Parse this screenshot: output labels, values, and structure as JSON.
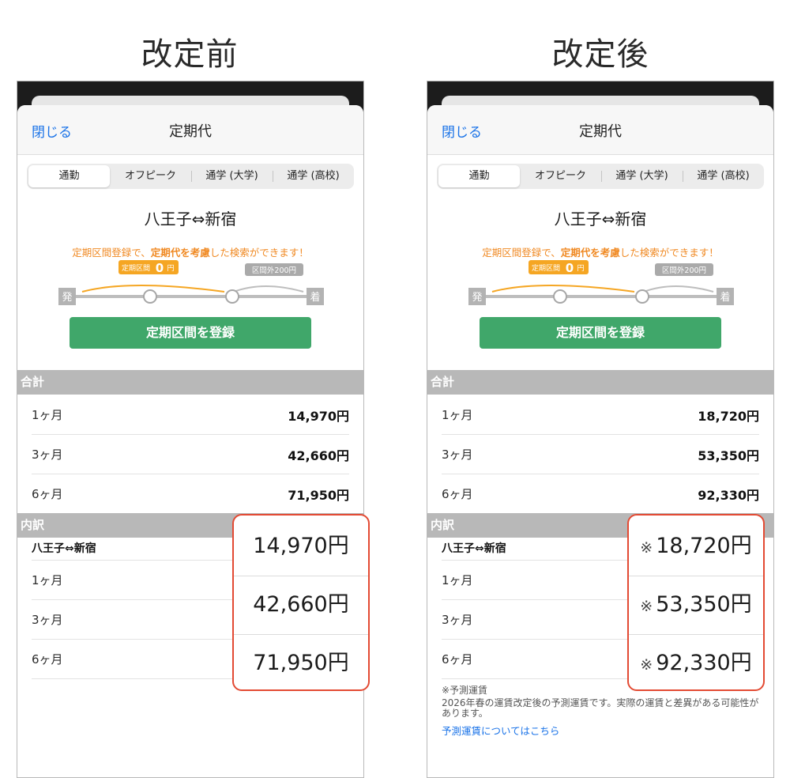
{
  "before": {
    "heading": "改定前",
    "nav": {
      "close_label": "閉じる",
      "title": "定期代"
    },
    "segments": [
      "通勤",
      "オフピーク",
      "通学 (大学)",
      "通学 (高校)"
    ],
    "route": "八王子⇔新宿",
    "promo": {
      "pre": "定期区間登録で、",
      "bold": "定期代を考慮",
      "post": "した検索ができます！"
    },
    "diagram": {
      "start": "発",
      "end": "着",
      "badge_in_pre": "定期区間",
      "badge_in_num": "0",
      "badge_in_unit": "円",
      "badge_out": "区間外200円"
    },
    "register_label": "定期区間を登録",
    "total_header": "合計",
    "totals": [
      {
        "label": "1ヶ月",
        "value": "14,970円"
      },
      {
        "label": "3ヶ月",
        "value": "42,660円"
      },
      {
        "label": "6ヶ月",
        "value": "71,950円"
      }
    ],
    "breakdown_header": "内訳",
    "breakdown_route": "八王子⇔新宿",
    "breakdown": [
      {
        "label": "1ヶ月",
        "value": "14,970円"
      },
      {
        "label": "3ヶ月",
        "value": "42,660円"
      },
      {
        "label": "6ヶ月",
        "value": "71,950円"
      }
    ]
  },
  "after": {
    "heading": "改定後",
    "nav": {
      "close_label": "閉じる",
      "title": "定期代"
    },
    "segments": [
      "通勤",
      "オフピーク",
      "通学 (大学)",
      "通学 (高校)"
    ],
    "route": "八王子⇔新宿",
    "promo": {
      "pre": "定期区間登録で、",
      "bold": "定期代を考慮",
      "post": "した検索ができます！"
    },
    "diagram": {
      "start": "発",
      "end": "着",
      "badge_in_pre": "定期区間",
      "badge_in_num": "0",
      "badge_in_unit": "円",
      "badge_out": "区間外200円"
    },
    "register_label": "定期区間を登録",
    "total_header": "合計",
    "totals": [
      {
        "label": "1ヶ月",
        "value": "18,720円"
      },
      {
        "label": "3ヶ月",
        "value": "53,350円"
      },
      {
        "label": "6ヶ月",
        "value": "92,330円"
      }
    ],
    "breakdown_header": "内訳",
    "breakdown_route": "八王子⇔新宿",
    "breakdown_mark": "※",
    "breakdown": [
      {
        "label": "1ヶ月",
        "value": "18,720円"
      },
      {
        "label": "3ヶ月",
        "value": "53,350円"
      },
      {
        "label": "6ヶ月",
        "value": "92,330円"
      }
    ],
    "note_title": "※予測運賃",
    "note_body": "2026年春の運賃改定後の予測運賃です。実際の運賃と差異がある可能性があります。",
    "note_link": "予測運賃についてはこちら"
  },
  "colors": {
    "accent": "#1a73e8",
    "brand_green": "#40a76a",
    "promo_orange": "#f08a24",
    "highlight_red": "#e34a33",
    "section_gray": "#b8b8b8"
  }
}
